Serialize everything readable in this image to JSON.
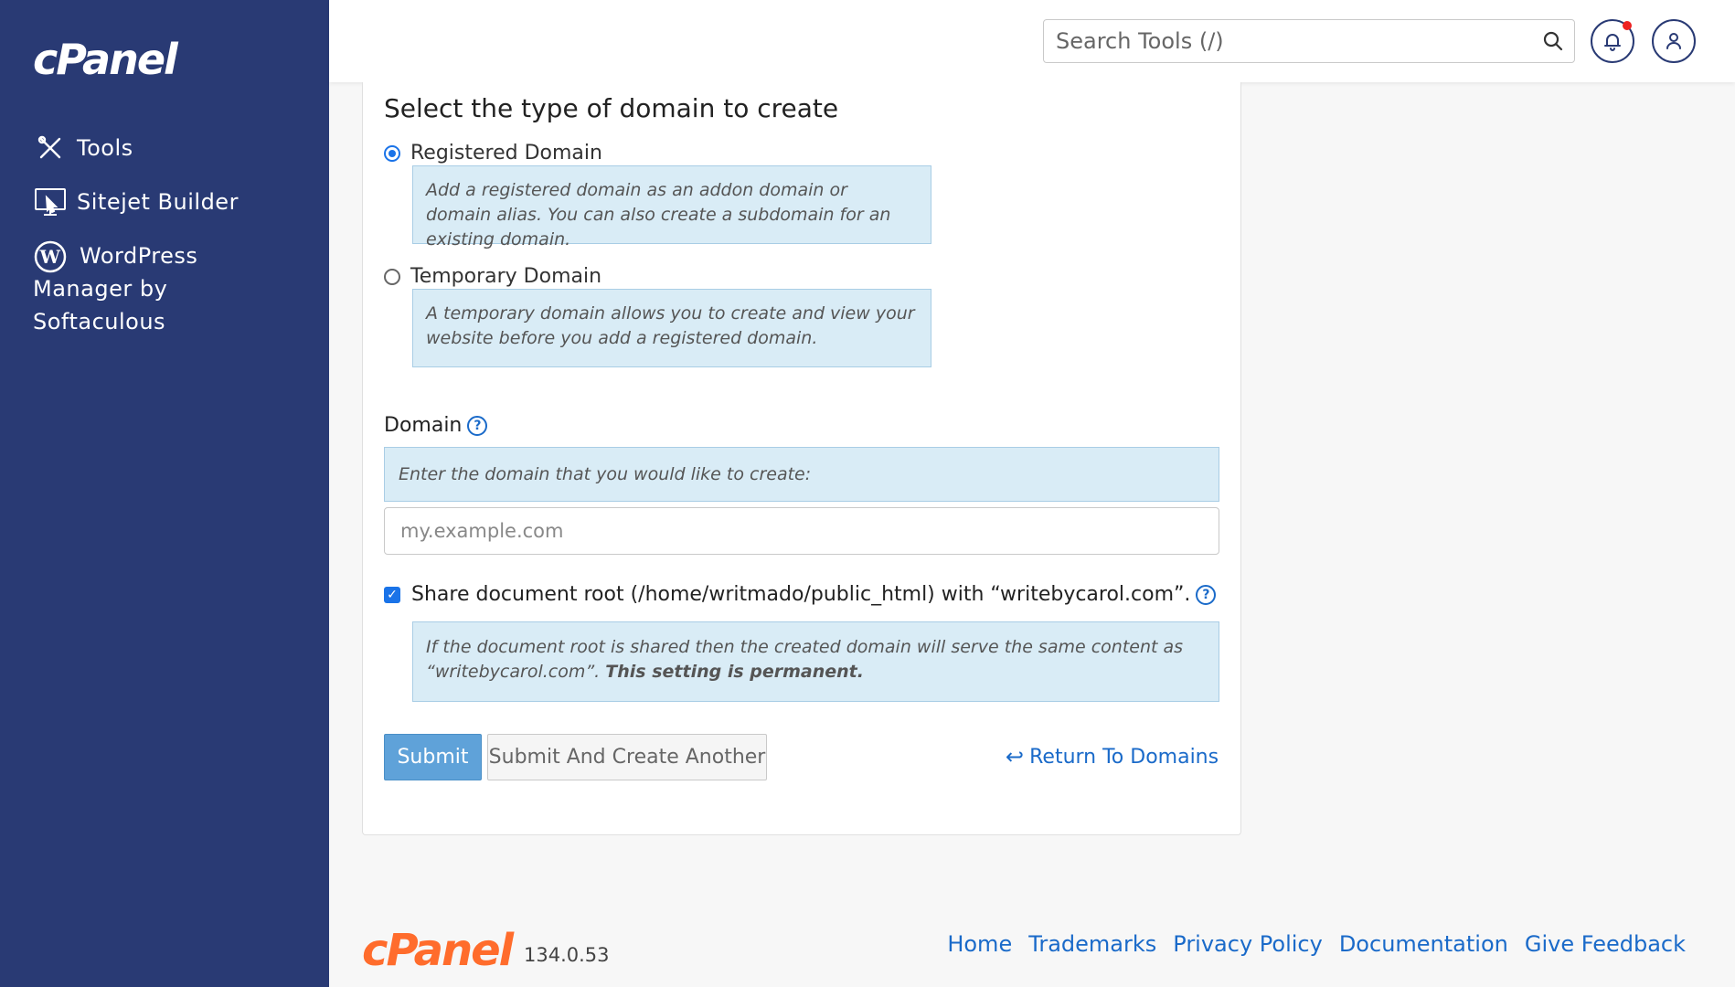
{
  "app": {
    "logo_text": "cPanel",
    "footer_logo_text": "cPanel",
    "version": "134.0.53"
  },
  "sidebar": {
    "items": [
      {
        "label": "Tools",
        "icon": "tools-icon"
      },
      {
        "label": "Sitejet Builder",
        "icon": "sitejet-icon"
      },
      {
        "label": "WordPress Manager by Softaculous",
        "icon": "wordpress-icon"
      }
    ]
  },
  "header": {
    "search_placeholder": "Search Tools (/)"
  },
  "form": {
    "section_title": "Select the type of domain to create",
    "options": [
      {
        "label": "Registered Domain",
        "selected": true,
        "description": "Add a registered domain as an addon domain or domain alias. You can also create a subdomain for an existing domain."
      },
      {
        "label": "Temporary Domain",
        "selected": false,
        "description": "A temporary domain allows you to create and view your website before you add a registered domain."
      }
    ],
    "domain_label": "Domain",
    "domain_hint": "Enter the domain that you would like to create:",
    "domain_placeholder": "my.example.com",
    "domain_value": "",
    "share_label": "Share document root (/home/writmado/public_html) with “writebycarol.com”.",
    "share_checked": true,
    "share_note": "If the document root is shared then the created domain will serve the same content as “writebycarol.com”.",
    "share_note_bold": "This setting is permanent.",
    "submit_label": "Submit",
    "submit_another_label": "Submit And Create Another",
    "return_label": "Return To Domains"
  },
  "footer": {
    "links": [
      "Home",
      "Trademarks",
      "Privacy Policy",
      "Documentation",
      "Give Feedback"
    ]
  },
  "colors": {
    "sidebar_bg": "#293a74",
    "accent": "#1a6ac9",
    "footer_logo": "#ff6c2c",
    "info_bg": "#d9ecf6"
  }
}
